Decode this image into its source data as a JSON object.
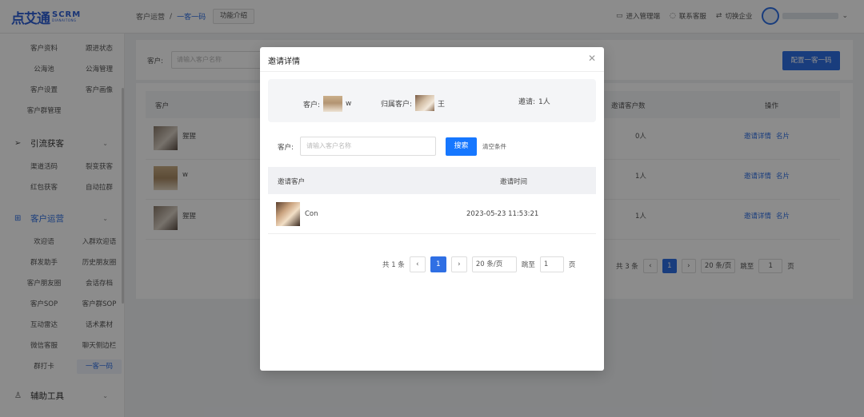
{
  "brand": {
    "mark": "点艾通",
    "scrm": "SCRM",
    "sub": "DIANAITONG"
  },
  "breadcrumb": {
    "first": "客户运营",
    "sep": "/",
    "current": "一客一码"
  },
  "func_intro": "功能介绍",
  "topright": {
    "admin": "进入管理端",
    "support": "联系客服",
    "switch": "切换企业"
  },
  "sidebar": {
    "group1": [
      [
        "客户资料",
        "跟进状态"
      ],
      [
        "公海池",
        "公海管理"
      ],
      [
        "客户设置",
        "客户画像"
      ],
      [
        "客户群管理",
        ""
      ]
    ],
    "head_traffic": "引流获客",
    "group2": [
      [
        "渠道活码",
        "裂变获客"
      ],
      [
        "红包获客",
        "自动拉群"
      ]
    ],
    "head_ops": "客户运营",
    "group3": [
      [
        "欢迎语",
        "入群欢迎语"
      ],
      [
        "群发助手",
        "历史朋友圈"
      ],
      [
        "客户朋友圈",
        "会话存档"
      ],
      [
        "客户SOP",
        "客户群SOP"
      ],
      [
        "互动雷达",
        "话术素材"
      ],
      [
        "微信客服",
        "聊天侧边栏"
      ],
      [
        "群打卡",
        "一客一码"
      ]
    ],
    "head_tools": "辅助工具"
  },
  "main": {
    "search_label": "客户:",
    "search_placeholder": "请输入客户名称",
    "config_button": "配置一客一码",
    "columns": {
      "customer": "客户",
      "invited": "邀请客户数",
      "ops": "操作"
    },
    "rows": [
      {
        "name": "猩猩",
        "count": "0人",
        "op1": "邀请详情",
        "op2": "名片"
      },
      {
        "name": "w",
        "count": "1人",
        "op1": "邀请详情",
        "op2": "名片"
      },
      {
        "name": "猩猩",
        "count": "1人",
        "op1": "邀请详情",
        "op2": "名片"
      }
    ],
    "pager": {
      "total": "共 3 条",
      "page": "1",
      "size": "20 条/页",
      "jump": "跳至",
      "jump_val": "1",
      "page_unit": "页"
    }
  },
  "modal": {
    "title": "邀请详情",
    "info": {
      "customer_label": "客户:",
      "customer_name": "w",
      "owner_label": "归属客户:",
      "owner_name": "王",
      "invite_label": "邀请:",
      "invite_value": "1人"
    },
    "filter": {
      "label": "客户:",
      "placeholder": "请输入客户名称",
      "search": "搜索",
      "clear": "清空条件"
    },
    "columns": {
      "invited_customer": "邀请客户",
      "invite_time": "邀请时间"
    },
    "rows": [
      {
        "name": "Con",
        "time": "2023-05-23 11:53:21"
      }
    ],
    "pager": {
      "total": "共 1 条",
      "page": "1",
      "size": "20 条/页",
      "jump": "跳至",
      "jump_val": "1",
      "page_unit": "页"
    }
  }
}
